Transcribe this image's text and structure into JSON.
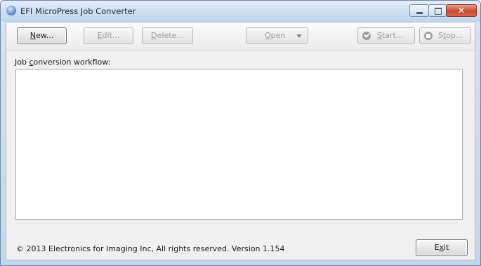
{
  "window": {
    "title": "EFI MicroPress Job Converter",
    "close_glyph": "✕"
  },
  "toolbar": {
    "new_label_u": "N",
    "new_label_rest": "ew...",
    "edit_label_u": "E",
    "edit_label_rest": "dit...",
    "delete_label_u": "D",
    "delete_label_rest": "elete...",
    "open_label_u": "O",
    "open_label_rest": "pen",
    "start_label_u": "S",
    "start_label_rest": "tart...",
    "stop_label_pre": "S",
    "stop_label_u": "t",
    "stop_label_rest": "op..."
  },
  "main": {
    "workflow_label_pre": "Job ",
    "workflow_label_u": "c",
    "workflow_label_rest": "onversion workflow:",
    "workflow_items": []
  },
  "footer": {
    "copyright": "© 2013 Electronics for Imaging Inc, All rights reserved.  Version 1.154",
    "exit_label_pre": "E",
    "exit_label_u": "x",
    "exit_label_rest": "it"
  },
  "icons": {
    "app": "app-globe-icon",
    "start": "check-circle-icon",
    "stop": "stop-circle-icon",
    "open_caret": "chevron-down-icon"
  },
  "colors": {
    "titlebar": "#cfdff1",
    "close_button": "#c64a32",
    "client_bg": "#f0f0f0",
    "disabled_text": "#9c9c9c"
  }
}
